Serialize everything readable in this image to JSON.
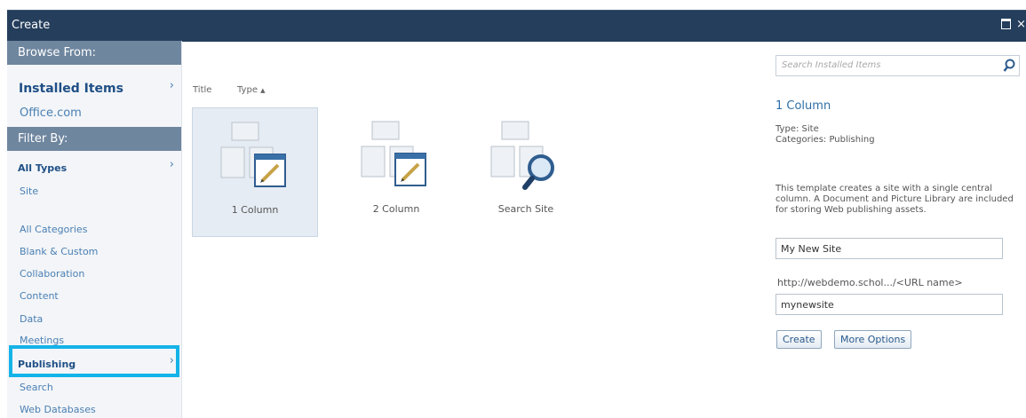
{
  "window": {
    "title": "Create"
  },
  "sidebar": {
    "browse_header": "Browse From:",
    "browse_items": [
      {
        "label": "Installed Items",
        "selected": true
      },
      {
        "label": "Office.com",
        "selected": false
      }
    ],
    "filter_header": "Filter By:",
    "type_items": [
      {
        "label": "All Types",
        "selected": true
      },
      {
        "label": "Site",
        "selected": false
      }
    ],
    "category_items": [
      {
        "label": "All Categories",
        "selected": false
      },
      {
        "label": "Blank & Custom",
        "selected": false
      },
      {
        "label": "Collaboration",
        "selected": false
      },
      {
        "label": "Content",
        "selected": false
      },
      {
        "label": "Data",
        "selected": false
      },
      {
        "label": "Meetings",
        "selected": false
      },
      {
        "label": "Publishing",
        "selected": true
      },
      {
        "label": "Search",
        "selected": false
      },
      {
        "label": "Web Databases",
        "selected": false
      }
    ]
  },
  "main": {
    "columns": {
      "title": "Title",
      "type": "Type",
      "type_sort": "▲"
    },
    "tiles": [
      {
        "label": "1 Column",
        "icon": "site-template-icon",
        "selected": true
      },
      {
        "label": "2 Column",
        "icon": "site-template-icon",
        "selected": false
      },
      {
        "label": "Search Site",
        "icon": "search-site-icon",
        "selected": false
      }
    ]
  },
  "details": {
    "search_placeholder": "Search Installed Items",
    "title": "1 Column",
    "type_line": "Type: Site",
    "categories_line": "Categories: Publishing",
    "description": "This template creates a site with a single central column. A Document and Picture Library are included for storing Web publishing assets.",
    "site_name_value": "My New Site",
    "url_label": "http://webdemo.schol.../<URL name>",
    "url_value": "mynewsite",
    "create_label": "Create",
    "more_options_label": "More Options"
  },
  "colors": {
    "titlebar": "#243e5c",
    "side_header": "#6f869f",
    "highlight": "#14b3e8",
    "link": "#4a7fb3"
  }
}
